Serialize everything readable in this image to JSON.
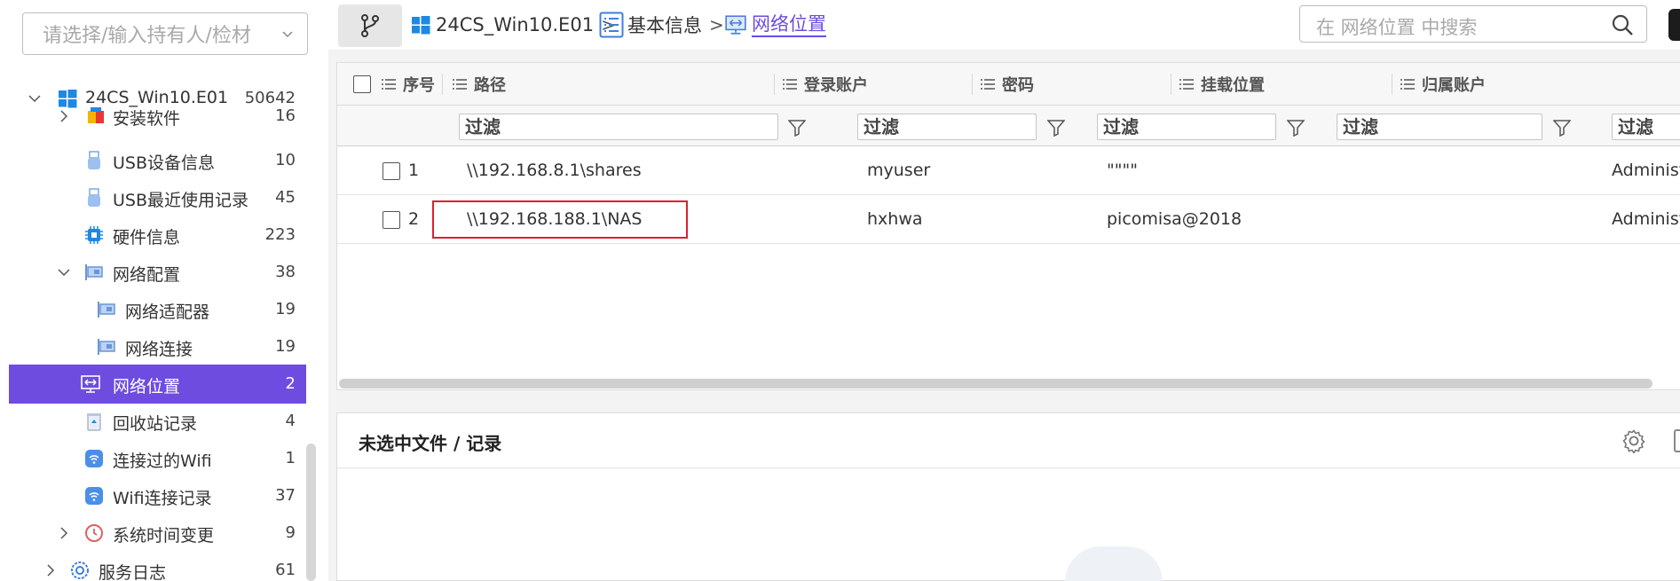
{
  "sidebar": {
    "owner_placeholder": "请选择/输入持有人/检材",
    "root": {
      "label": "24CS_Win10.E01",
      "count": "50642"
    },
    "items": [
      {
        "label": "安装软件",
        "count": "16",
        "icon": "package-icon"
      },
      {
        "label": "USB设备信息",
        "count": "10",
        "icon": "usb-icon"
      },
      {
        "label": "USB最近使用记录",
        "count": "45",
        "icon": "usb-icon"
      },
      {
        "label": "硬件信息",
        "count": "223",
        "icon": "chip-icon"
      },
      {
        "label": "网络配置",
        "count": "38",
        "icon": "network-card-icon"
      },
      {
        "label": "网络适配器",
        "count": "19",
        "icon": "network-card-icon"
      },
      {
        "label": "网络连接",
        "count": "19",
        "icon": "network-card-icon"
      },
      {
        "label": "网络位置",
        "count": "2",
        "icon": "network-location-icon"
      },
      {
        "label": "回收站记录",
        "count": "4",
        "icon": "recycle-bin-icon"
      },
      {
        "label": "连接过的Wifi",
        "count": "1",
        "icon": "wifi-icon"
      },
      {
        "label": "Wifi连接记录",
        "count": "37",
        "icon": "wifi-icon"
      },
      {
        "label": "系统时间变更",
        "count": "9",
        "icon": "clock-icon"
      },
      {
        "label": "服务日志",
        "count": "61",
        "icon": "service-icon"
      }
    ]
  },
  "breadcrumb": {
    "items": [
      "24CS_Win10.E01",
      "基本信息",
      "网络位置"
    ],
    "separator": ">"
  },
  "search": {
    "placeholder": "在 网络位置 中搜索"
  },
  "table": {
    "columns": [
      "序号",
      "路径",
      "登录账户",
      "密码",
      "挂载位置",
      "归属账户"
    ],
    "filter_placeholder": "过滤",
    "rows": [
      {
        "index": "1",
        "path": "\\\\192.168.8.1\\shares",
        "account": "myuser",
        "password": "\"\"\"\"",
        "mount": "",
        "owner": "Administrator"
      },
      {
        "index": "2",
        "path": "\\\\192.168.188.1\\NAS",
        "account": "hxhwa",
        "password": "picomisa@2018",
        "mount": "",
        "owner": "Administrator"
      }
    ]
  },
  "detail": {
    "title": "未选中文件 / 记录"
  },
  "colors": {
    "accent": "#6e4cdf",
    "highlight_red": "#e0202a",
    "windows_blue": "#1e88e5"
  }
}
